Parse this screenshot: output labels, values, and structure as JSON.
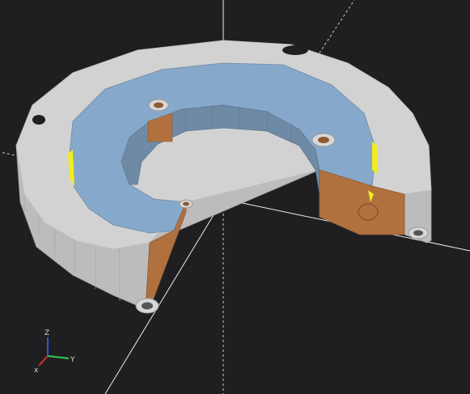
{
  "viewport": {
    "background": "#1f1f21",
    "scene_axes": {
      "positive_color": "#eeeeee",
      "negative_style": "dashed"
    }
  },
  "model": {
    "top_ring_color": "#d2d2d2",
    "outer_wall_color": "#bcbcbc",
    "top_face_color": "#86a8ca",
    "inner_wall_color": "#6f8aa5",
    "cut_face_color": "#b0713f",
    "highlight_color": "#f2ee1c",
    "hole_color": "#8f5a32"
  },
  "axes_gizmo": {
    "x_label": "x",
    "y_label": "Y",
    "z_label": "Z",
    "x_color": "#cc3333",
    "y_color": "#33cc55",
    "z_color": "#3355dd"
  }
}
